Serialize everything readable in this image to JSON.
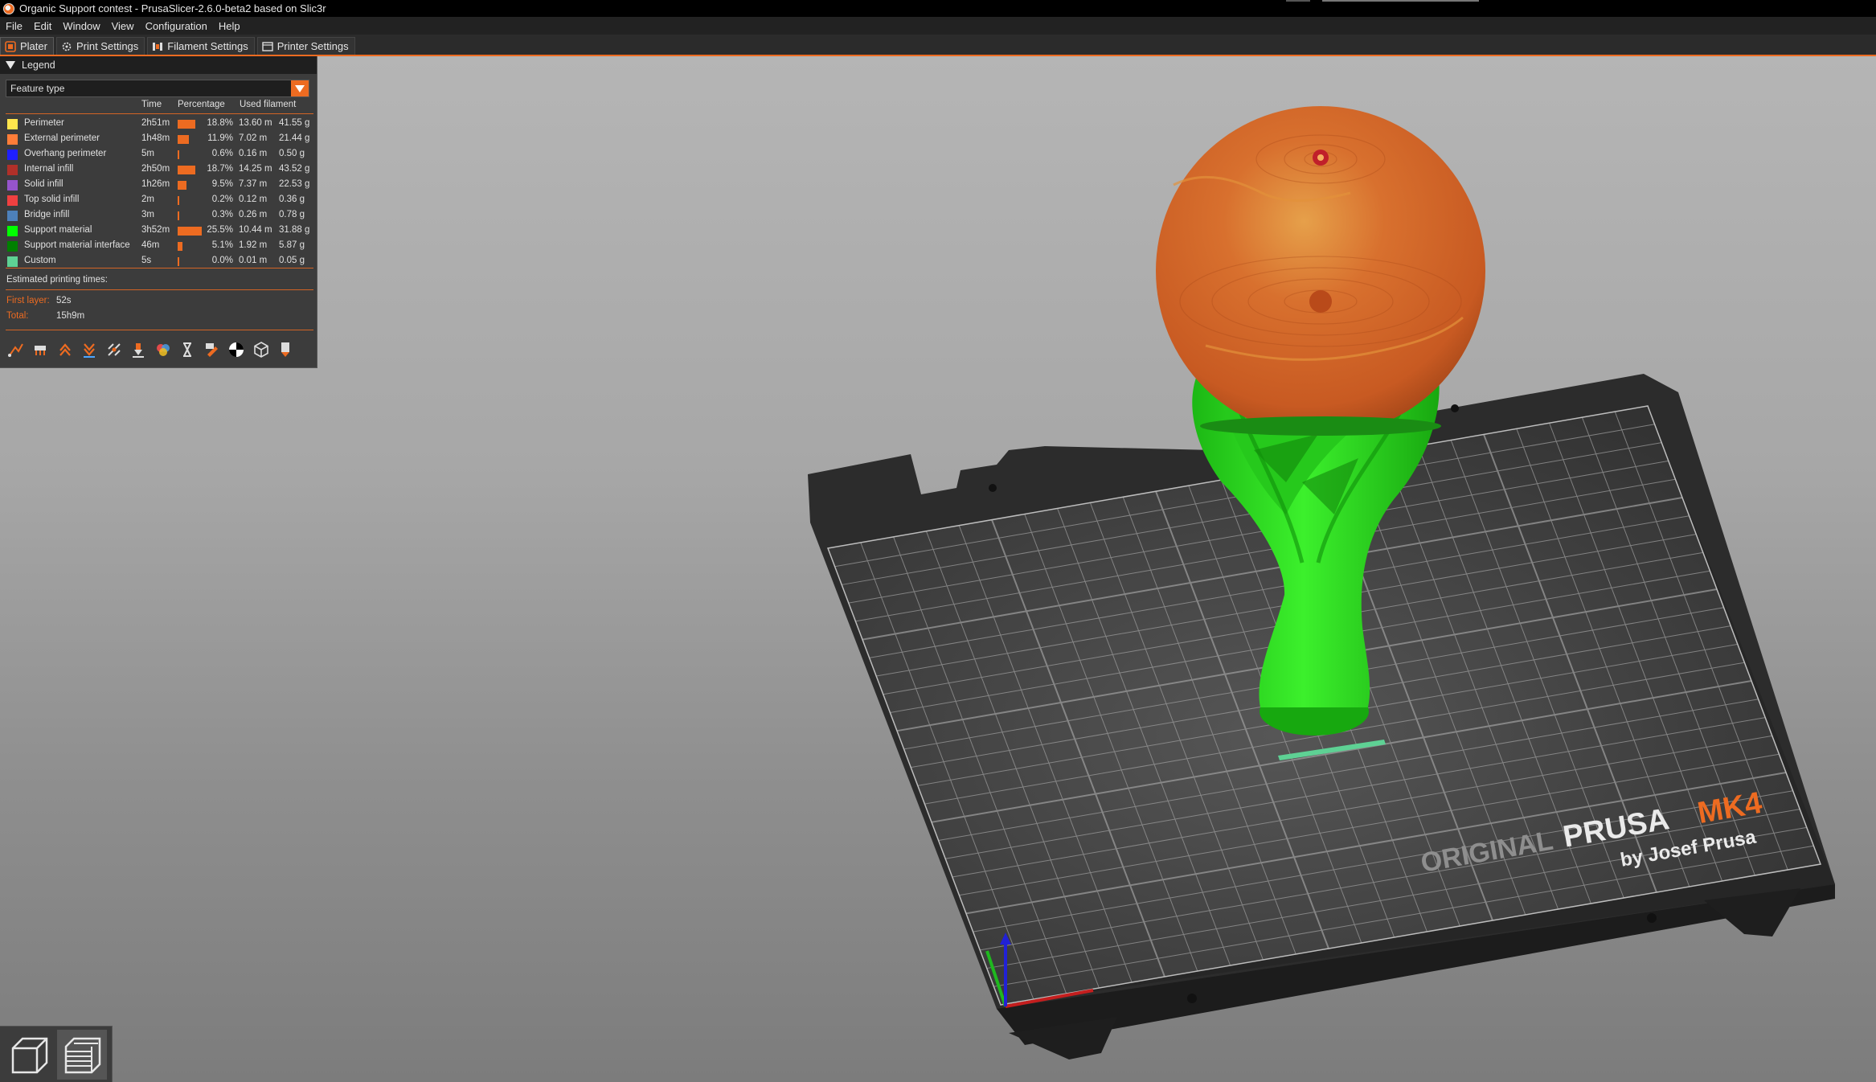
{
  "window": {
    "title": "Organic Support contest - PrusaSlicer-2.6.0-beta2 based on Slic3r"
  },
  "menu": [
    "File",
    "Edit",
    "Window",
    "View",
    "Configuration",
    "Help"
  ],
  "tabs": [
    {
      "label": "Plater",
      "icon": "plater-icon",
      "active": true
    },
    {
      "label": "Print Settings",
      "icon": "print-settings-icon",
      "active": false
    },
    {
      "label": "Filament Settings",
      "icon": "filament-settings-icon",
      "active": false
    },
    {
      "label": "Printer Settings",
      "icon": "printer-settings-icon",
      "active": false
    }
  ],
  "legend": {
    "title": "Legend",
    "view_type": "Feature type",
    "columns": {
      "time": "Time",
      "percentage": "Percentage",
      "used_filament": "Used filament"
    },
    "rows": [
      {
        "label": "Perimeter",
        "color": "#ffe64d",
        "time": "2h51m",
        "percent": 18.8,
        "percent_text": "18.8%",
        "length": "13.60 m",
        "weight": "41.55 g"
      },
      {
        "label": "External perimeter",
        "color": "#ff7d38",
        "time": "1h48m",
        "percent": 11.9,
        "percent_text": "11.9%",
        "length": "7.02 m",
        "weight": "21.44 g"
      },
      {
        "label": "Overhang perimeter",
        "color": "#1f1fff",
        "time": "5m",
        "percent": 0.6,
        "percent_text": "0.6%",
        "length": "0.16 m",
        "weight": "0.50 g"
      },
      {
        "label": "Internal infill",
        "color": "#b03029",
        "time": "2h50m",
        "percent": 18.7,
        "percent_text": "18.7%",
        "length": "14.25 m",
        "weight": "43.52 g"
      },
      {
        "label": "Solid infill",
        "color": "#9654cc",
        "time": "1h26m",
        "percent": 9.5,
        "percent_text": "9.5%",
        "length": "7.37 m",
        "weight": "22.53 g"
      },
      {
        "label": "Top solid infill",
        "color": "#f04040",
        "time": "2m",
        "percent": 0.2,
        "percent_text": "0.2%",
        "length": "0.12 m",
        "weight": "0.36 g"
      },
      {
        "label": "Bridge infill",
        "color": "#4d80ba",
        "time": "3m",
        "percent": 0.3,
        "percent_text": "0.3%",
        "length": "0.26 m",
        "weight": "0.78 g"
      },
      {
        "label": "Support material",
        "color": "#00ff00",
        "time": "3h52m",
        "percent": 25.5,
        "percent_text": "25.5%",
        "length": "10.44 m",
        "weight": "31.88 g"
      },
      {
        "label": "Support material interface",
        "color": "#008000",
        "time": "46m",
        "percent": 5.1,
        "percent_text": "5.1%",
        "length": "1.92 m",
        "weight": "5.87 g"
      },
      {
        "label": "Custom",
        "color": "#5ed194",
        "time": "5s",
        "percent": 0.0,
        "percent_text": "0.0%",
        "length": "0.01 m",
        "weight": "0.05 g"
      }
    ],
    "estimated": {
      "title": "Estimated printing times:",
      "first_layer_label": "First layer:",
      "first_layer_value": "52s",
      "total_label": "Total:",
      "total_value": "15h9m"
    },
    "toolbar_icons": [
      "travel-icon",
      "wipe-icon",
      "retractions-icon",
      "deretractions-icon",
      "seams-icon",
      "tool-changes-icon",
      "color-changes-icon",
      "pause-prints-icon",
      "custom-gcodes-icon",
      "center-of-gravity-icon",
      "shells-icon",
      "tool-marker-icon"
    ]
  },
  "bed": {
    "brand_line1": "ORIGINAL",
    "brand_line2": "PRUSA",
    "brand_line3": "MK4",
    "brand_line4": "by Josef Prusa"
  },
  "view_buttons": [
    {
      "name": "3d-view-icon",
      "active": false
    },
    {
      "name": "preview-layers-icon",
      "active": true
    }
  ],
  "colors": {
    "accent": "#ed6b21",
    "panel": "#3c3c3c",
    "support": "#22e01a",
    "model": "#d9662a"
  }
}
